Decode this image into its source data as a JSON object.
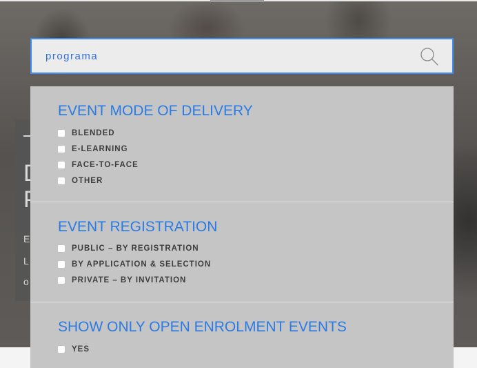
{
  "search": {
    "value": "programa",
    "placeholder": ""
  },
  "hero": {
    "letters": {
      "l1": "D",
      "l2": "P",
      "l3": "E",
      "l4": "L",
      "l5": "o"
    }
  },
  "filters": {
    "delivery": {
      "title": "EVENT MODE OF DELIVERY",
      "options": [
        "BLENDED",
        "E-LEARNING",
        "FACE-TO-FACE",
        "OTHER"
      ]
    },
    "registration": {
      "title": "EVENT REGISTRATION",
      "options": [
        "PUBLIC – BY REGISTRATION",
        "BY APPLICATION & SELECTION",
        "PRIVATE – BY INVITATION"
      ]
    },
    "open_enrolment": {
      "title": "SHOW ONLY OPEN ENROLMENT EVENTS",
      "options": [
        "YES"
      ]
    }
  },
  "colors": {
    "accent": "#2a7be4",
    "search_border": "#3e8ef7",
    "panel_bg": "#c5c5c5",
    "option_text": "#3d3d3d"
  },
  "icons": {
    "search": "search-icon",
    "checkbox": "checkbox-icon"
  }
}
